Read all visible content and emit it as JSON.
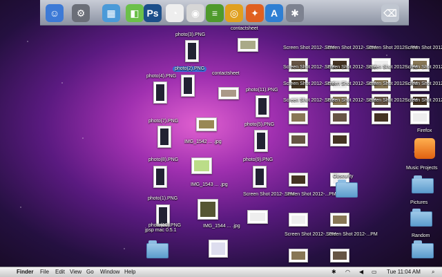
{
  "dock": {
    "items": [
      {
        "name": "finder-icon",
        "color": "#3d7ad6",
        "glyph": "☺"
      },
      {
        "name": "launchpad-icon",
        "color": "#6b6f78",
        "glyph": "⚙"
      },
      {
        "name": "photos-icon",
        "color": "#4b9ad8",
        "glyph": "▦"
      },
      {
        "name": "preview-icon",
        "color": "#6cc04a",
        "glyph": "◧"
      },
      {
        "name": "photoshop-icon",
        "color": "#1c4f8a",
        "glyph": "Ps"
      },
      {
        "name": "timer-icon",
        "color": "#eeeeee",
        "glyph": "◔"
      },
      {
        "name": "chrome-icon",
        "color": "#d6d6d6",
        "glyph": "◉"
      },
      {
        "name": "spotify-icon",
        "color": "#4f9a2c",
        "glyph": "≡"
      },
      {
        "name": "chrome-browser-icon",
        "color": "#e0a020",
        "glyph": "◎"
      },
      {
        "name": "firefox-icon",
        "color": "#e06020",
        "glyph": "✦"
      },
      {
        "name": "app-store-icon",
        "color": "#2f7fd3",
        "glyph": "A"
      },
      {
        "name": "settings-icon",
        "color": "#7d8290",
        "glyph": "✱"
      },
      {
        "name": "trash-icon",
        "color": "#c0c6d0",
        "glyph": "⌫"
      }
    ]
  },
  "menubar": {
    "app": "Finder",
    "menus": [
      "File",
      "Edit",
      "View",
      "Go",
      "Window",
      "Help"
    ],
    "clock": "Tue 11:04 AM",
    "wifi_icon": "wifi-icon",
    "battery_icon": "battery-icon"
  },
  "desktop": {
    "photo_labels": [
      "photo(3).PNG",
      "photo(2).PNG",
      "photo(4).PNG",
      "photo(11).PNG",
      "photo(7).PNG",
      "photo(5).PNG",
      "photo(8).PNG",
      "photo(9).PNG",
      "photo(1).PNG",
      "photo(6).PNG"
    ],
    "screenshot_label": "Screen Shot 2012-...PM",
    "misc_labels": [
      "Firefox",
      "Music Projects",
      "Pictures",
      "Random",
      "Obscurity",
      "contactsheet",
      "contactsheet",
      "IMG_1542 ... .jpg",
      "IMG_1543 ... .jpg",
      "IMG_1544 ... .jpg",
      "jpsp mac 0.5.1",
      "photo(10).PNG"
    ]
  }
}
